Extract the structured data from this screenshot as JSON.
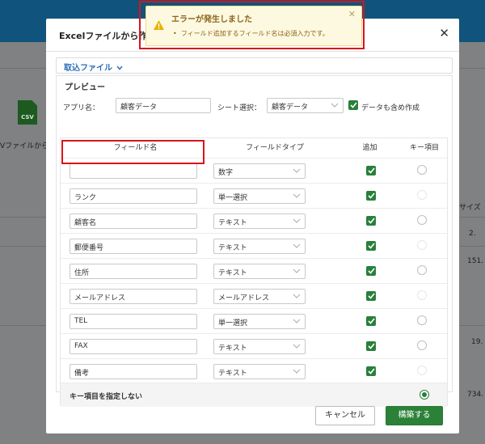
{
  "background": {
    "csv_icon_label": "CSV",
    "csv_text": "Vファイルから",
    "size_header": "サイズ",
    "values": [
      "2.",
      "151.",
      "19.",
      "734."
    ]
  },
  "modal": {
    "title": "Excelファイルから作成",
    "import_file_link": "取込ファイル",
    "preview_title": "プレビュー",
    "app_name_label": "アプリ名：",
    "app_name_value": "顧客データ",
    "sheet_label": "シート選択：",
    "sheet_value": "顧客データ",
    "include_data_label": "データも含め作成",
    "columns": {
      "field_name": "フィールド名",
      "field_type": "フィールドタイプ",
      "add": "追加",
      "key": "キー項目"
    },
    "rows": [
      {
        "name": "",
        "type": "数字",
        "add": true,
        "key_radio": "normal"
      },
      {
        "name": "ランク",
        "type": "単一選択",
        "add": true,
        "key_radio": "dim"
      },
      {
        "name": "顧客名",
        "type": "テキスト",
        "add": true,
        "key_radio": "normal"
      },
      {
        "name": "郵便番号",
        "type": "テキスト",
        "add": true,
        "key_radio": "dim"
      },
      {
        "name": "住所",
        "type": "テキスト",
        "add": true,
        "key_radio": "normal"
      },
      {
        "name": "メールアドレス",
        "type": "メールアドレス",
        "add": true,
        "key_radio": "dim"
      },
      {
        "name": "TEL",
        "type": "単一選択",
        "add": true,
        "key_radio": "normal"
      },
      {
        "name": "FAX",
        "type": "テキスト",
        "add": true,
        "key_radio": "normal"
      },
      {
        "name": "備考",
        "type": "テキスト",
        "add": true,
        "key_radio": "dim"
      }
    ],
    "no_key_label": "キー項目を指定しない",
    "cancel_button": "キャンセル",
    "build_button": "構築する"
  },
  "toast": {
    "title": "エラーが発生しました",
    "message": "フィールド追加するフィールド名は必須入力です。"
  },
  "colors": {
    "accent_green": "#2a8137",
    "error_red": "#d8141b",
    "link_blue": "#2a6db5",
    "header_blue": "#10537d"
  }
}
